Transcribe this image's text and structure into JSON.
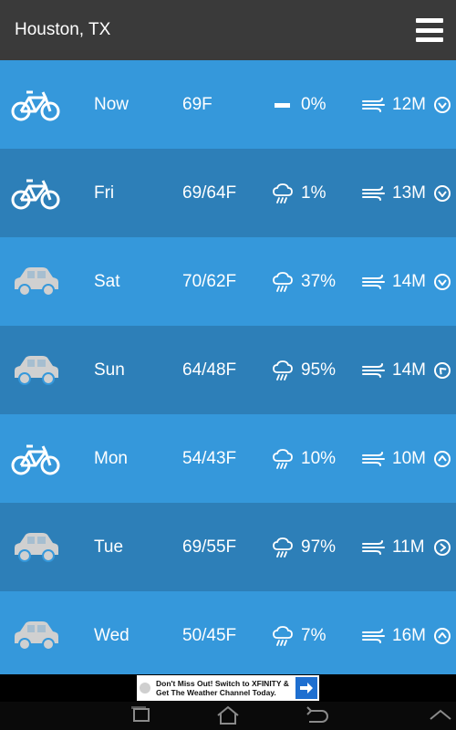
{
  "header": {
    "title": "Houston, TX",
    "menu_icon": "hamburger-menu-icon"
  },
  "colors": {
    "header_bg": "#3a3a3a",
    "row_light": "#3598db",
    "row_dark": "#2d7fb8",
    "icon_gray": "#d0d0d0",
    "text": "#ffffff"
  },
  "rows": [
    {
      "mode": "bicycle-icon",
      "day": "Now",
      "temp": "69F",
      "precip_icon": "dash-icon",
      "precip": "0%",
      "wind": "12M",
      "direction": "down"
    },
    {
      "mode": "bicycle-icon",
      "day": "Fri",
      "temp": "69/64F",
      "precip_icon": "rain-cloud-icon",
      "precip": "1%",
      "wind": "13M",
      "direction": "down"
    },
    {
      "mode": "car-icon",
      "day": "Sat",
      "temp": "70/62F",
      "precip_icon": "rain-cloud-icon",
      "precip": "37%",
      "wind": "14M",
      "direction": "down"
    },
    {
      "mode": "car-icon",
      "day": "Sun",
      "temp": "64/48F",
      "precip_icon": "rain-cloud-icon",
      "precip": "95%",
      "wind": "14M",
      "direction": "up-left"
    },
    {
      "mode": "bicycle-icon",
      "day": "Mon",
      "temp": "54/43F",
      "precip_icon": "rain-cloud-icon",
      "precip": "10%",
      "wind": "10M",
      "direction": "up"
    },
    {
      "mode": "car-icon",
      "day": "Tue",
      "temp": "69/55F",
      "precip_icon": "rain-cloud-icon",
      "precip": "97%",
      "wind": "11M",
      "direction": "right"
    },
    {
      "mode": "car-icon",
      "day": "Wed",
      "temp": "50/45F",
      "precip_icon": "rain-cloud-icon",
      "precip": "7%",
      "wind": "16M",
      "direction": "up"
    }
  ],
  "ad": {
    "line1": "Don't Miss Out! Switch to XFINITY &",
    "line2": "Get The Weather Channel Today."
  },
  "navbar": {
    "icons": [
      "recent-apps-icon",
      "home-icon",
      "back-icon",
      "collapse-icon"
    ]
  }
}
